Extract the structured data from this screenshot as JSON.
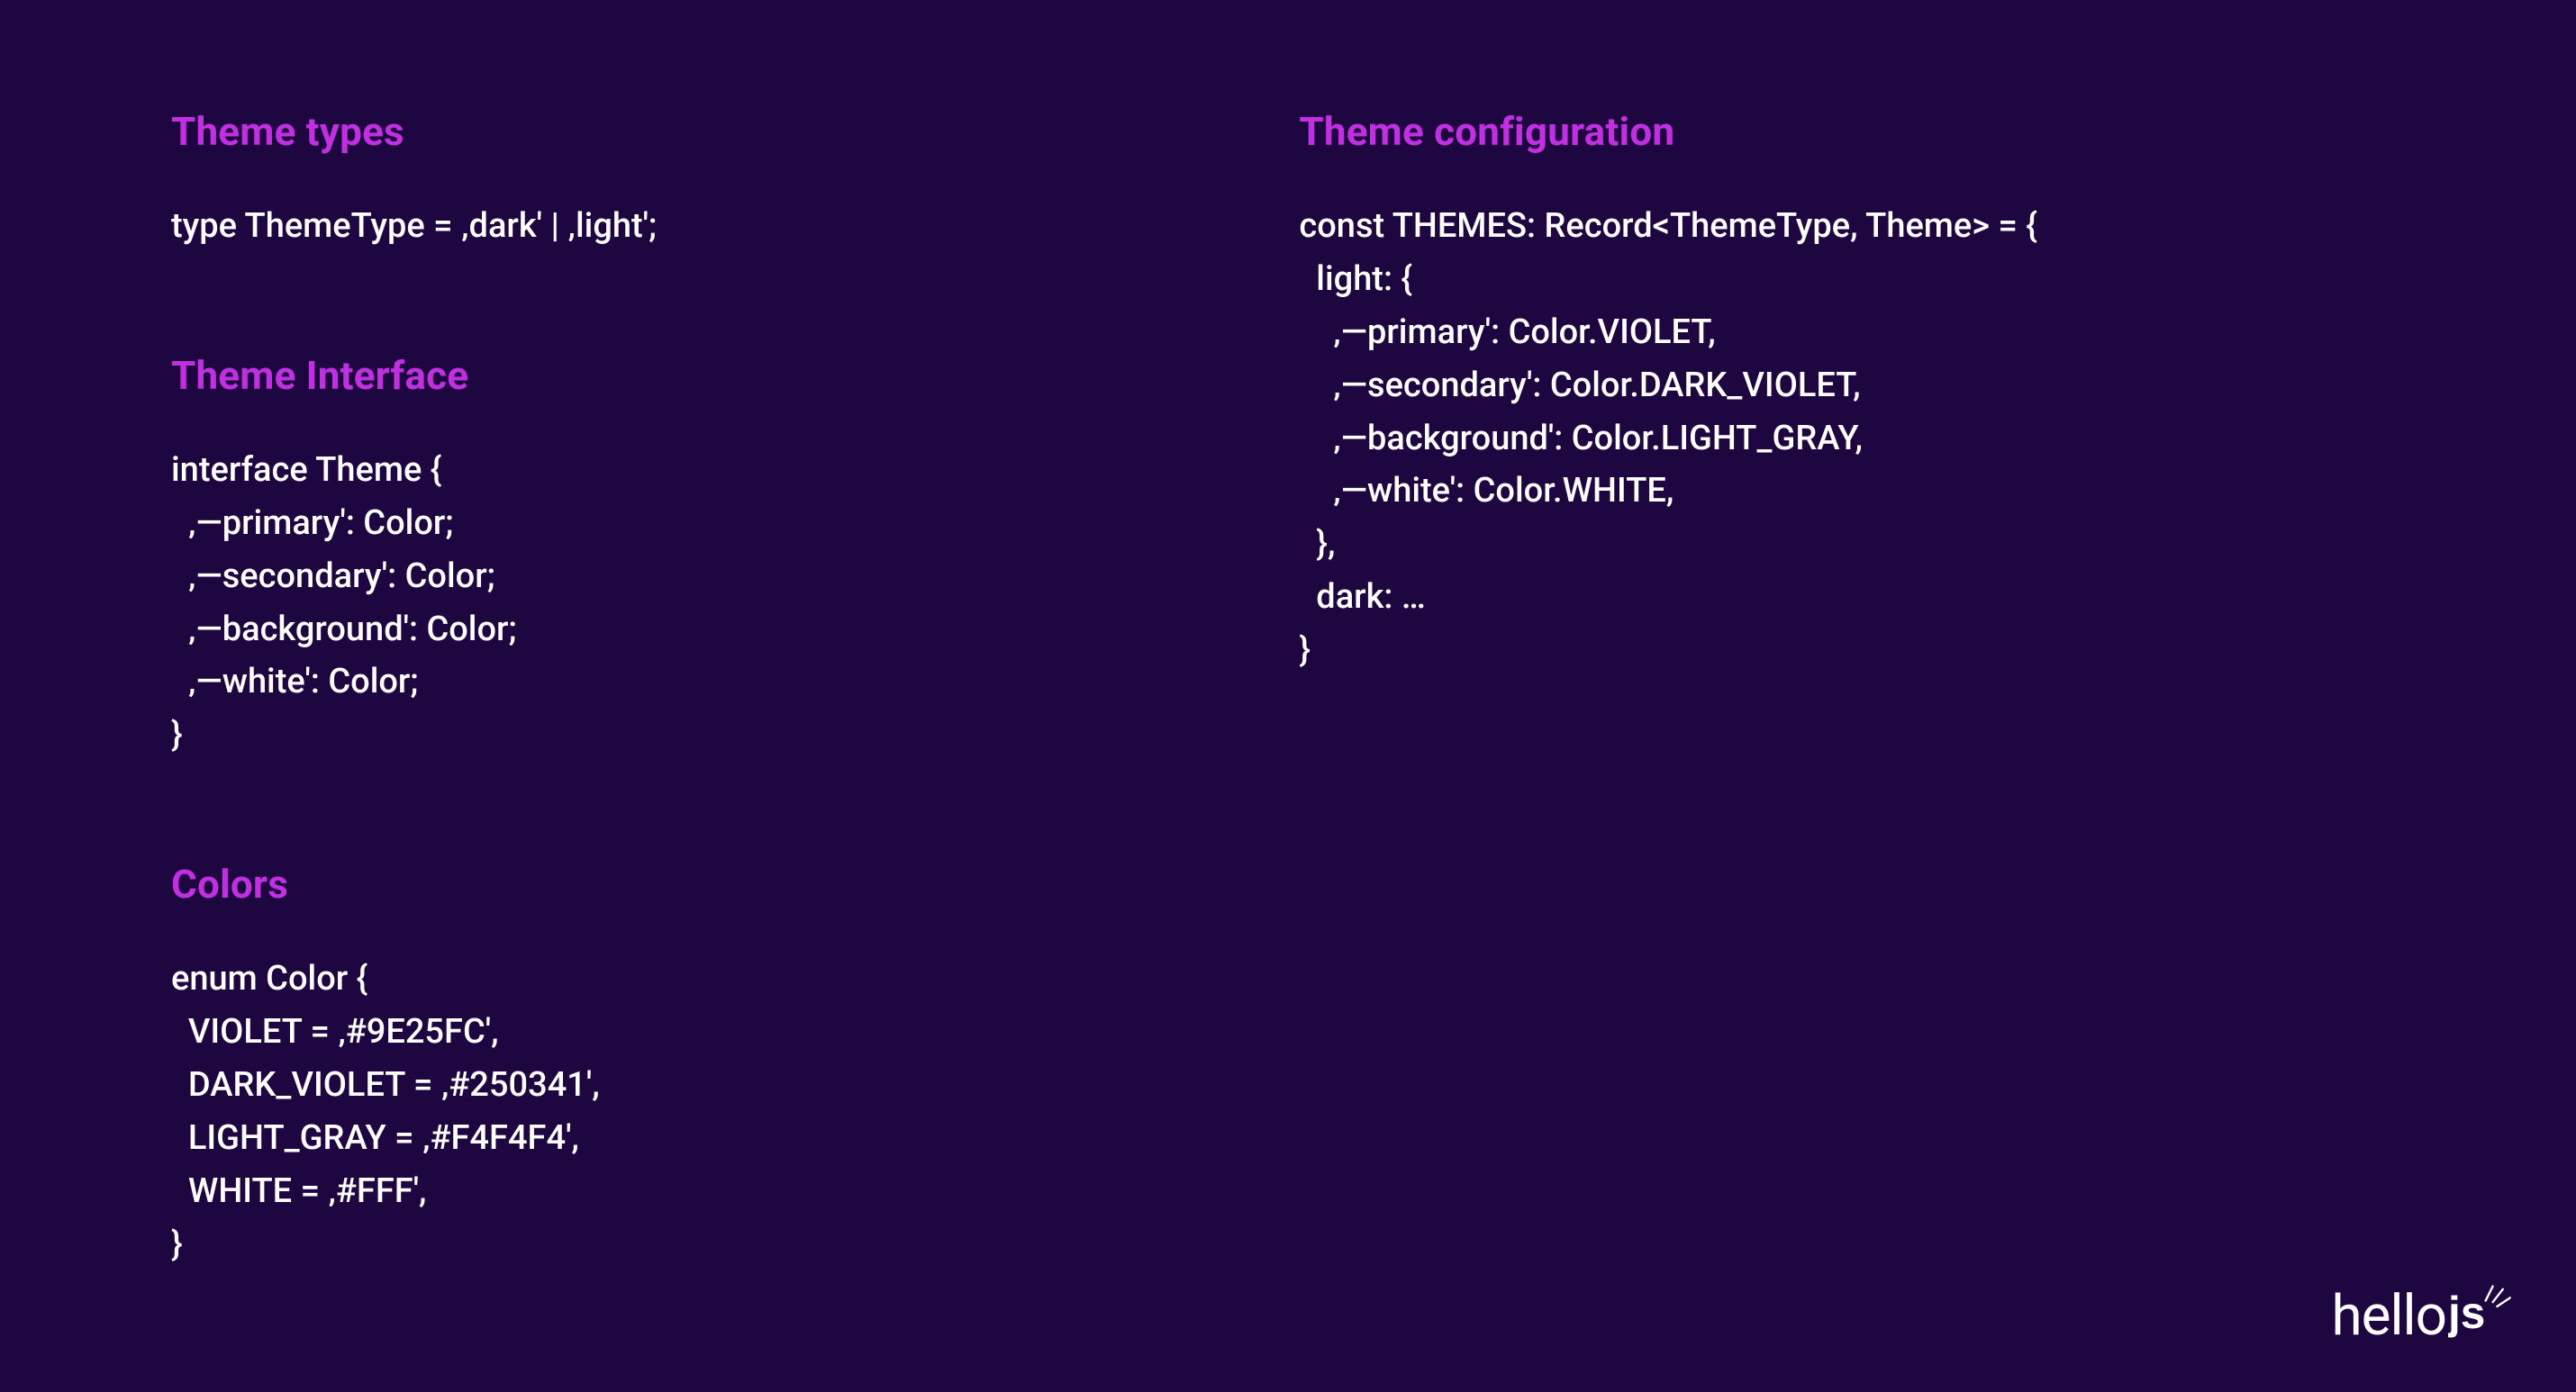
{
  "left": {
    "types": {
      "heading": "Theme types",
      "code": "type ThemeType = ‚dark' | ‚light';"
    },
    "interface": {
      "heading": "Theme Interface",
      "code": "interface Theme {\n  ‚—primary': Color;\n  ‚—secondary': Color;\n  ‚—background': Color;\n  ‚—white': Color;\n}"
    },
    "colors": {
      "heading": "Colors",
      "code": "enum Color {\n  VIOLET = ‚#9E25FC',\n  DARK_VIOLET = ‚#250341',\n  LIGHT_GRAY = ‚#F4F4F4',\n  WHITE = ‚#FFF',\n}"
    }
  },
  "right": {
    "config": {
      "heading": "Theme configuration",
      "code": "const THEMES: Record<ThemeType, Theme> = {\n  light: {\n    ‚—primary': Color.VIOLET,\n    ‚—secondary': Color.DARK_VIOLET,\n    ‚—background': Color.LIGHT_GRAY,\n    ‚—white': Color.WHITE,\n  },\n  dark: …\n}"
    }
  },
  "logo": {
    "text_prefix": "hello"
  }
}
